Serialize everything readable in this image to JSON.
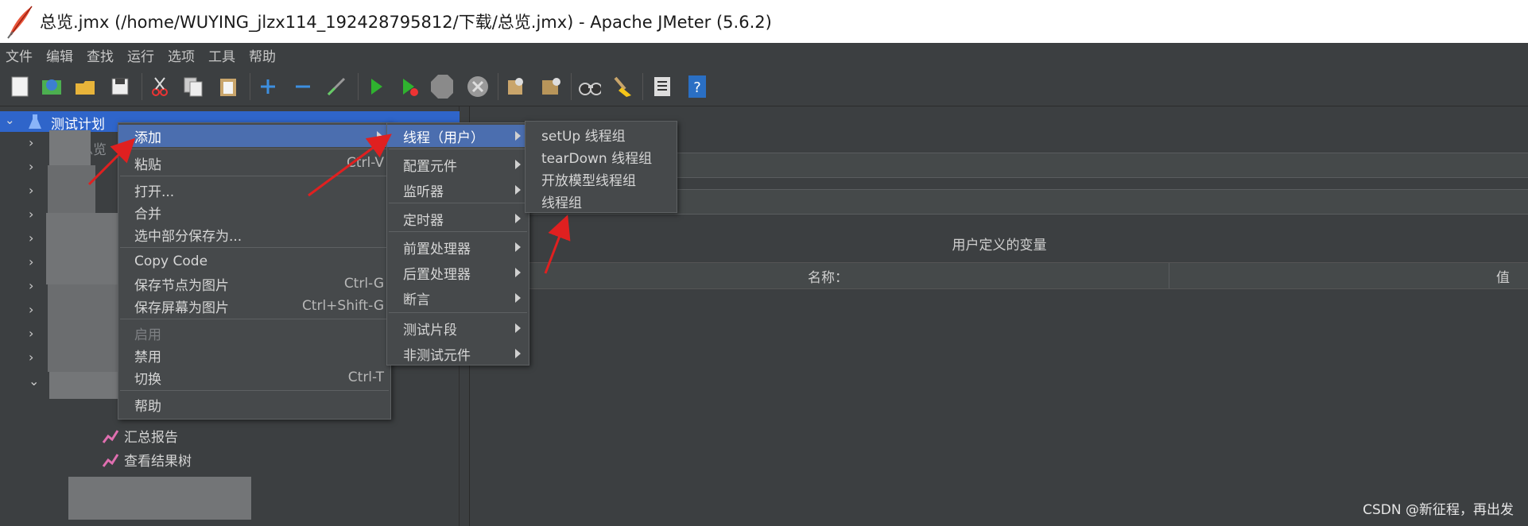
{
  "window": {
    "title": "总览.jmx (/home/WUYING_jlzx114_192428795812/下载/总览.jmx) - Apache JMeter (5.6.2)"
  },
  "menubar": [
    "文件",
    "编辑",
    "查找",
    "运行",
    "选项",
    "工具",
    "帮助"
  ],
  "toolbar": {
    "icons": [
      "new-icon",
      "templates-icon",
      "open-icon",
      "save-icon",
      "cut-icon",
      "copy-icon",
      "paste-icon",
      "expand-icon",
      "collapse-icon",
      "toggle-icon",
      "start-icon",
      "start-no-pause-icon",
      "stop-icon",
      "shutdown-icon",
      "clear-icon",
      "clear-all-icon",
      "search-icon",
      "reset-search-icon",
      "function-helper-icon",
      "help-icon"
    ]
  },
  "tree": {
    "root_label": "测试计划",
    "visible_items": [
      {
        "label": "总览"
      },
      {
        "label": "汇总报告"
      },
      {
        "label": "查看结果树"
      }
    ]
  },
  "context_menu": {
    "items": [
      {
        "label": "添加",
        "shortcut": "",
        "submenu": true,
        "selected": true
      },
      {
        "label": "粘贴",
        "shortcut": "Ctrl-V"
      },
      {
        "label": "打开...",
        "shortcut": ""
      },
      {
        "label": "合并",
        "shortcut": ""
      },
      {
        "label": "选中部分保存为...",
        "shortcut": ""
      },
      {
        "label": "Copy Code",
        "shortcut": ""
      },
      {
        "label": "保存节点为图片",
        "shortcut": "Ctrl-G"
      },
      {
        "label": "保存屏幕为图片",
        "shortcut": "Ctrl+Shift-G"
      },
      {
        "label": "启用",
        "shortcut": "",
        "disabled": true
      },
      {
        "label": "禁用",
        "shortcut": ""
      },
      {
        "label": "切换",
        "shortcut": "Ctrl-T"
      },
      {
        "label": "帮助",
        "shortcut": ""
      }
    ]
  },
  "add_submenu": {
    "items": [
      {
        "label": "线程（用户）",
        "selected": true
      },
      {
        "label": "配置元件"
      },
      {
        "label": "监听器"
      },
      {
        "label": "定时器"
      },
      {
        "label": "前置处理器"
      },
      {
        "label": "后置处理器"
      },
      {
        "label": "断言"
      },
      {
        "label": "测试片段"
      },
      {
        "label": "非测试元件"
      }
    ]
  },
  "threads_submenu": {
    "items": [
      {
        "label": "setUp 线程组"
      },
      {
        "label": "tearDown 线程组"
      },
      {
        "label": "开放模型线程组"
      },
      {
        "label": "线程组"
      }
    ]
  },
  "right_panel": {
    "vars_title": "用户定义的变量",
    "col_name": "名称：",
    "col_value": "值"
  },
  "watermark": "CSDN @新征程，再出发",
  "colors": {
    "selection": "#4b6eaf",
    "tree_selection": "#2f65ca",
    "annotation_arrow": "#e02020"
  }
}
